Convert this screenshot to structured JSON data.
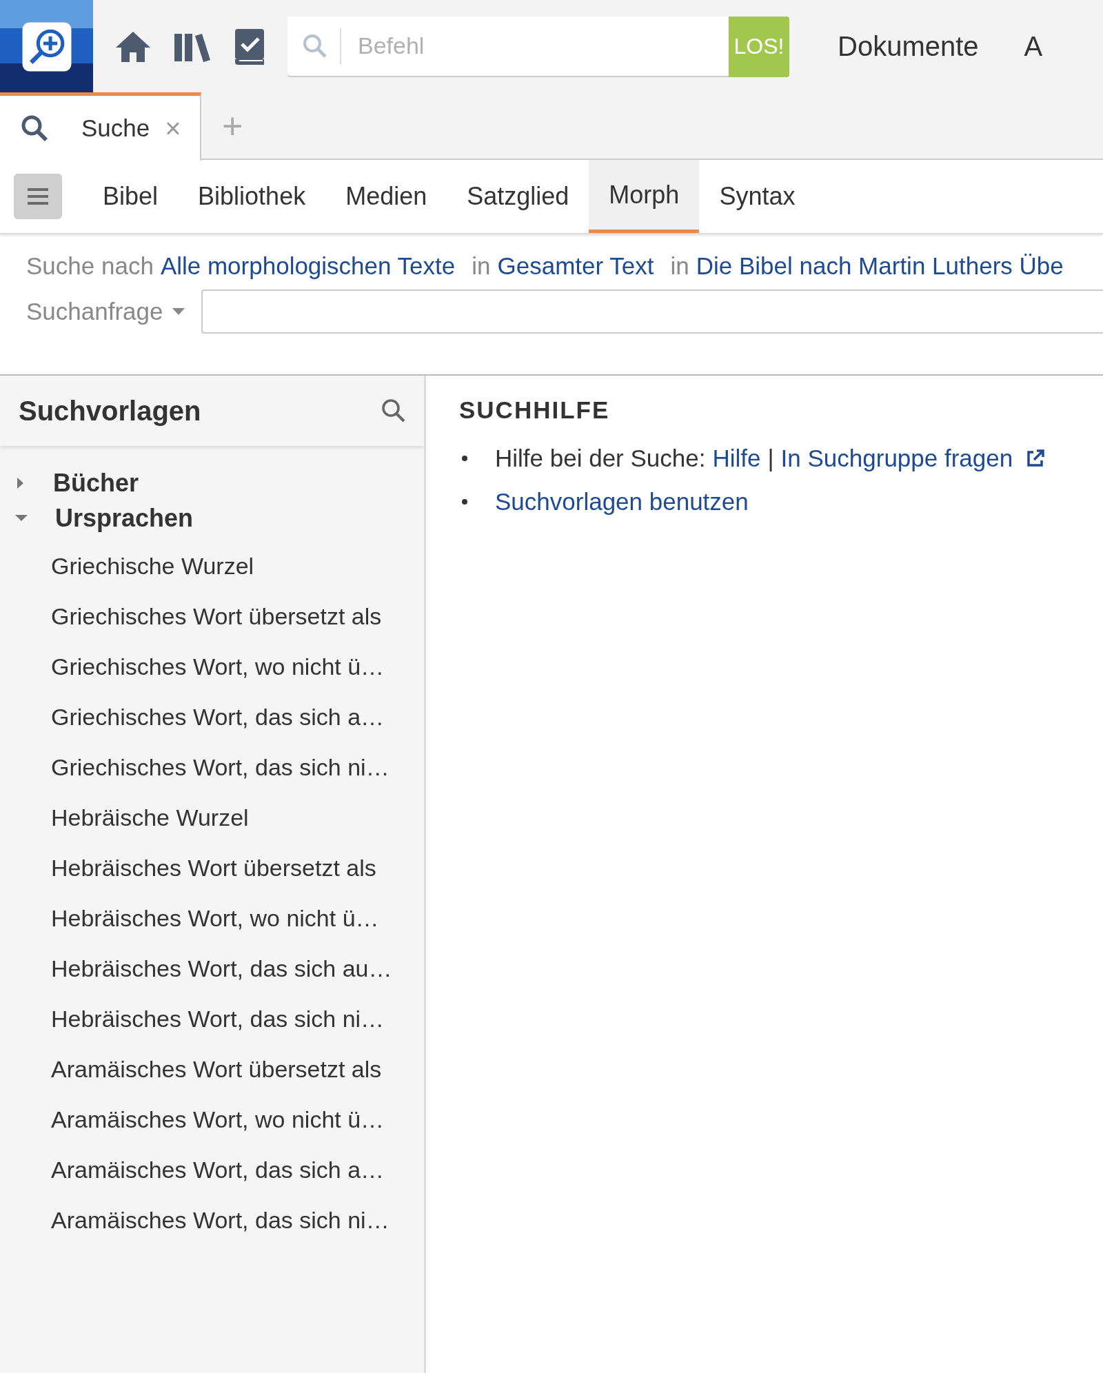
{
  "toolbar": {
    "search": {
      "placeholder": "Befehl"
    },
    "go_button": "LOS!",
    "menu_items": [
      "Dokumente",
      "A"
    ]
  },
  "tabs": [
    {
      "label": "Suche",
      "selected": true,
      "close": "×"
    }
  ],
  "add_tab": "+",
  "search_types": [
    {
      "label": "Bibel",
      "selected": false
    },
    {
      "label": "Bibliothek",
      "selected": false
    },
    {
      "label": "Medien",
      "selected": false
    },
    {
      "label": "Satzglied",
      "selected": false
    },
    {
      "label": "Morph",
      "selected": true
    },
    {
      "label": "Syntax",
      "selected": false
    }
  ],
  "search_scope": [
    {
      "kind": "plain",
      "text": "Suche nach"
    },
    {
      "kind": "link",
      "text": "Alle morphologischen Texte"
    },
    {
      "kind": "plain",
      "text": "in"
    },
    {
      "kind": "link",
      "text": "Gesamter Text"
    },
    {
      "kind": "plain",
      "text": "in"
    },
    {
      "kind": "link",
      "text": "Die Bibel nach Martin Luthers Übe"
    }
  ],
  "query": {
    "label": "Suchanfrage"
  },
  "sidebar": {
    "title": "Suchvorlagen",
    "items": [
      {
        "label": "Bücher",
        "expanded": false
      },
      {
        "label": "Ursprachen",
        "expanded": true,
        "children": [
          {
            "label": "Griechische Wurzel"
          },
          {
            "label": "Griechisches Wort übersetzt als"
          },
          {
            "label": "Griechisches Wort, wo nicht ü…"
          },
          {
            "label": "Griechisches Wort, das sich a…"
          },
          {
            "label": "Griechisches Wort, das sich ni…"
          },
          {
            "label": "Hebräische Wurzel"
          },
          {
            "label": "Hebräisches Wort übersetzt als"
          },
          {
            "label": "Hebräisches Wort, wo nicht ü…"
          },
          {
            "label": "Hebräisches Wort, das sich au…"
          },
          {
            "label": "Hebräisches Wort, das sich ni…"
          },
          {
            "label": "Aramäisches Wort übersetzt als"
          },
          {
            "label": "Aramäisches Wort, wo nicht ü…"
          },
          {
            "label": "Aramäisches Wort, das sich a…"
          },
          {
            "label": "Aramäisches Wort, das sich ni…"
          }
        ]
      }
    ]
  },
  "help": {
    "title": "SUCHHILFE",
    "items": [
      {
        "parts": [
          {
            "kind": "plain",
            "text": "Hilfe bei der Suche:"
          },
          {
            "kind": "link",
            "text": "Hilfe"
          },
          {
            "kind": "plain",
            "text": "|"
          },
          {
            "kind": "external",
            "text": "In Suchgruppe fragen"
          }
        ]
      },
      {
        "parts": [
          {
            "kind": "link",
            "text": "Suchvorlagen benutzen"
          }
        ]
      }
    ]
  }
}
